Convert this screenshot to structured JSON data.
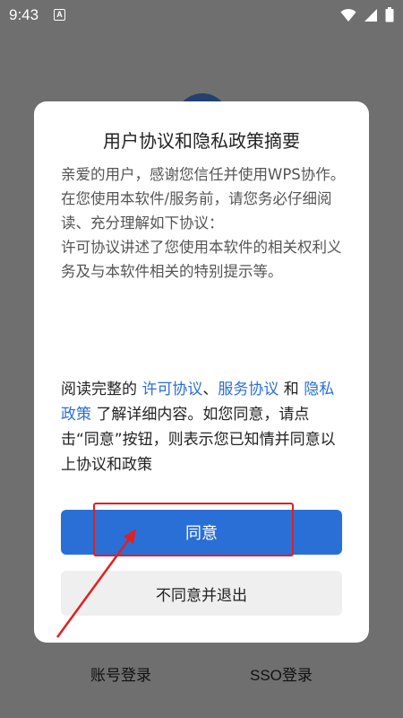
{
  "status_bar": {
    "time": "9:43",
    "a_label": "A"
  },
  "background": {
    "login_account": "账号登录",
    "login_sso": "SSO登录"
  },
  "dialog": {
    "title": "用户协议和隐私政策摘要",
    "summary": [
      "亲爱的用户，感谢您信任并使用WPS协作。",
      "在您使用本软件/服务前，请您务必仔细阅读、充分理解如下协议：",
      "许可协议讲述了您使用本软件的相关权利义务及与本软件相关的特别提示等。"
    ],
    "notice": {
      "prefix": "阅读完整的 ",
      "link_license": "许可协议",
      "sep1": "、",
      "link_service": "服务协议",
      "sep2": " 和 ",
      "link_privacy": "隐私政策",
      "suffix": " 了解详细内容。如您同意，请点击“同意”按钮，则表示您已知情并同意以上协议和政策"
    },
    "agree_label": "同意",
    "decline_label": "不同意并退出"
  },
  "colors": {
    "link": "#2a6fd6",
    "primary_button": "#2a6fd6",
    "highlight": "#e02020"
  }
}
